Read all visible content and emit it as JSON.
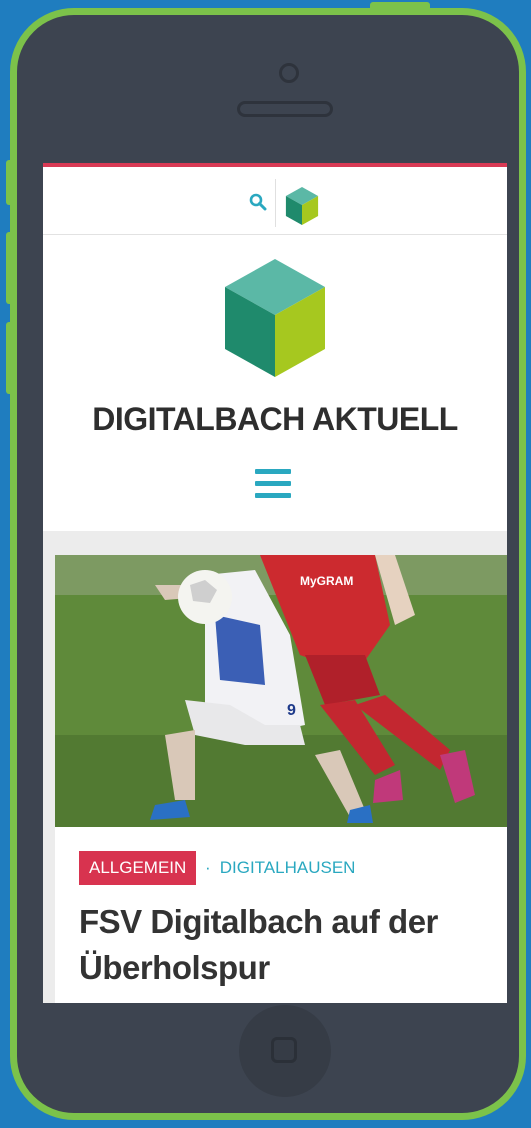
{
  "site": {
    "title": "DIGITALBACH AKTUELL"
  },
  "icons": {
    "search": "search-icon",
    "logo": "cube-logo-icon",
    "menu": "hamburger-menu-icon"
  },
  "colors": {
    "accent_red": "#d93a55",
    "accent_teal": "#2aa8c0",
    "phone_frame": "#7cc24a",
    "background": "#1f7dbf"
  },
  "article": {
    "category": "ALLGEMEIN",
    "separator": "·",
    "subcategory": "DIGITALHAUSEN",
    "title": "FSV Digitalbach auf der Überholspur",
    "jersey_text": "MyGRAM",
    "jersey_number": "9"
  }
}
